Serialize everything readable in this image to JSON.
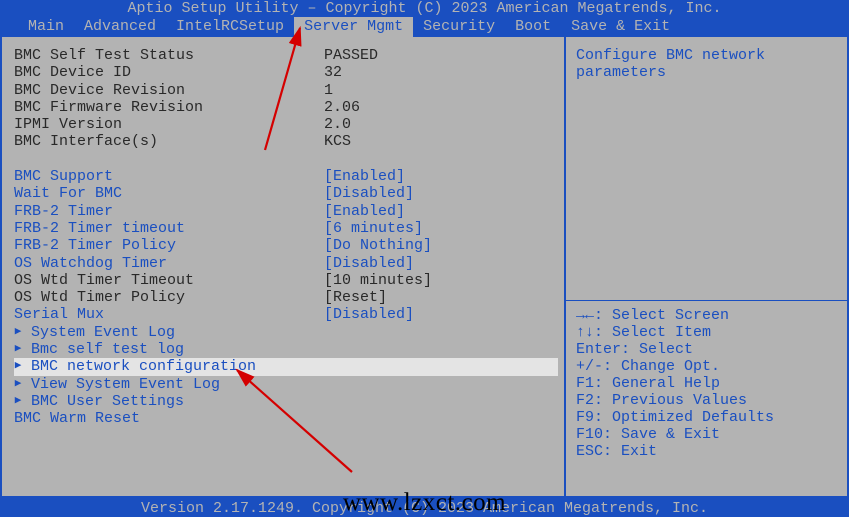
{
  "header": {
    "title": "Aptio Setup Utility – Copyright (C) 2023 American Megatrends, Inc.",
    "footer": "Version 2.17.1249. Copyright (C) 2023 American Megatrends, Inc."
  },
  "menu": {
    "items": [
      {
        "label": "Main"
      },
      {
        "label": "Advanced"
      },
      {
        "label": "IntelRCSetup"
      },
      {
        "label": "Server Mgmt"
      },
      {
        "label": "Security"
      },
      {
        "label": "Boot"
      },
      {
        "label": "Save & Exit"
      }
    ],
    "active_index": 3
  },
  "info": [
    {
      "label": "BMC Self Test Status",
      "value": "PASSED"
    },
    {
      "label": "BMC Device ID",
      "value": "32"
    },
    {
      "label": "BMC Device Revision",
      "value": "1"
    },
    {
      "label": "BMC Firmware Revision",
      "value": "2.06"
    },
    {
      "label": "IPMI Version",
      "value": "2.0"
    },
    {
      "label": "BMC Interface(s)",
      "value": "KCS"
    }
  ],
  "settings": [
    {
      "label": "BMC Support",
      "value": "[Enabled]",
      "type": "opt"
    },
    {
      "label": "Wait For BMC",
      "value": "[Disabled]",
      "type": "opt"
    },
    {
      "label": "FRB-2 Timer",
      "value": "[Enabled]",
      "type": "opt"
    },
    {
      "label": "FRB-2 Timer timeout",
      "value": "[6 minutes]",
      "type": "opt"
    },
    {
      "label": "FRB-2 Timer Policy",
      "value": "[Do Nothing]",
      "type": "opt"
    },
    {
      "label": "OS Watchdog Timer",
      "value": "[Disabled]",
      "type": "opt"
    },
    {
      "label": "OS Wtd Timer Timeout",
      "value": "[10 minutes]",
      "type": "readonly"
    },
    {
      "label": "OS Wtd Timer Policy",
      "value": "[Reset]",
      "type": "readonly"
    },
    {
      "label": "Serial Mux",
      "value": "[Disabled]",
      "type": "opt"
    },
    {
      "label": "System Event Log",
      "value": "",
      "type": "submenu"
    },
    {
      "label": "Bmc self test log",
      "value": "",
      "type": "submenu"
    },
    {
      "label": "BMC network configuration",
      "value": "",
      "type": "submenu",
      "selected": true
    },
    {
      "label": "View System Event Log",
      "value": "",
      "type": "submenu"
    },
    {
      "label": "BMC User Settings",
      "value": "",
      "type": "submenu"
    },
    {
      "label": "BMC Warm Reset",
      "value": "",
      "type": "action"
    }
  ],
  "help": {
    "description": "Configure BMC network parameters",
    "keys": [
      "→←: Select Screen",
      "↑↓: Select Item",
      "Enter: Select",
      "+/-: Change Opt.",
      "F1: General Help",
      "F2: Previous Values",
      "F9: Optimized Defaults",
      "F10: Save & Exit",
      "ESC: Exit"
    ]
  },
  "watermark": "www.lzxct.com"
}
